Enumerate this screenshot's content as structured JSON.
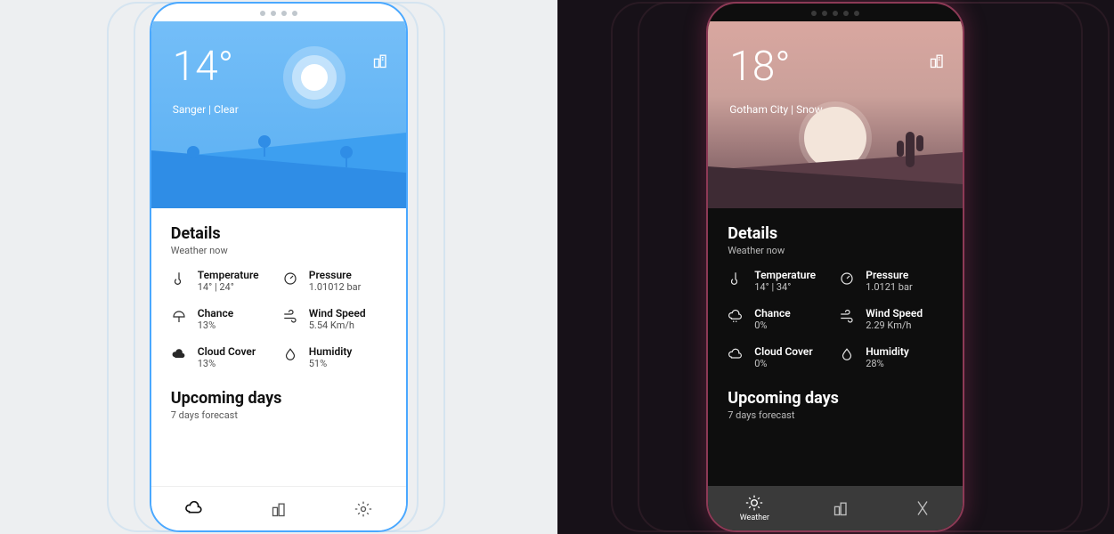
{
  "light": {
    "temp": "14°",
    "location": "Sanger",
    "condition": "Clear",
    "details_title": "Details",
    "details_sub": "Weather now",
    "metrics": {
      "temperature": {
        "label": "Temperature",
        "value": "14° | 24°"
      },
      "pressure": {
        "label": "Pressure",
        "value": "1.01012 bar"
      },
      "chance": {
        "label": "Chance",
        "value": "13%"
      },
      "wind": {
        "label": "Wind Speed",
        "value": "5.54 Km/h"
      },
      "cloud": {
        "label": "Cloud Cover",
        "value": "13%"
      },
      "humidity": {
        "label": "Humidity",
        "value": "51%"
      }
    },
    "upcoming_title": "Upcoming days",
    "upcoming_sub": "7 days forecast",
    "nav": {
      "weather": "Weather",
      "locations": "Locations",
      "settings": "Settings"
    }
  },
  "dark": {
    "temp": "18°",
    "location": "Gotham City",
    "condition": "Snow",
    "details_title": "Details",
    "details_sub": "Weather now",
    "metrics": {
      "temperature": {
        "label": "Temperature",
        "value": "14° | 34°"
      },
      "pressure": {
        "label": "Pressure",
        "value": "1.0121 bar"
      },
      "chance": {
        "label": "Chance",
        "value": "0%"
      },
      "wind": {
        "label": "Wind Speed",
        "value": "2.29 Km/h"
      },
      "cloud": {
        "label": "Cloud Cover",
        "value": "0%"
      },
      "humidity": {
        "label": "Humidity",
        "value": "28%"
      }
    },
    "upcoming_title": "Upcoming days",
    "upcoming_sub": "7 days forecast",
    "nav": {
      "weather": "Weather",
      "locations": "Locations",
      "settings": "Settings"
    }
  }
}
